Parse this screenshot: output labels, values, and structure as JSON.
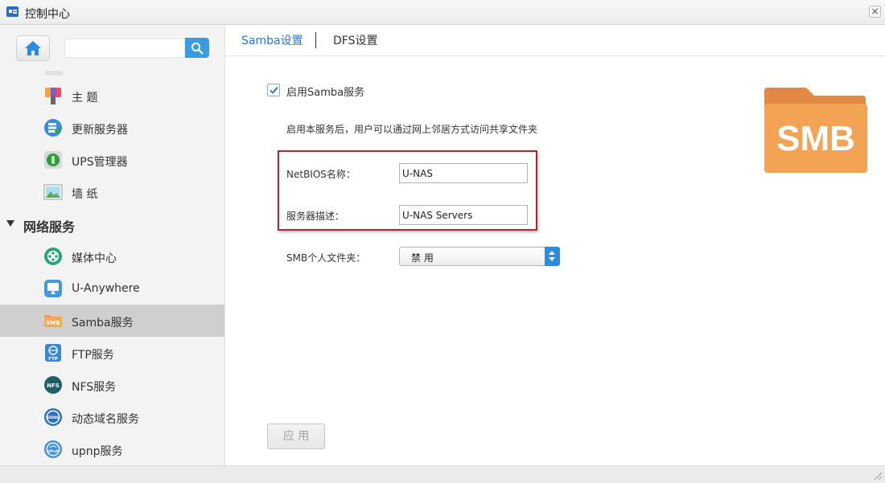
{
  "window": {
    "title": "控制中心"
  },
  "sidebar": {
    "search": {
      "value": "",
      "placeholder": ""
    },
    "items_top": [
      {
        "label": "主 题",
        "icon": "theme-icon"
      },
      {
        "label": "更新服务器",
        "icon": "update-server-icon"
      },
      {
        "label": "UPS管理器",
        "icon": "ups-icon"
      },
      {
        "label": "墙 纸",
        "icon": "wallpaper-icon"
      }
    ],
    "section": {
      "label": "网络服务"
    },
    "items_network": [
      {
        "label": "媒体中心",
        "icon": "media-center-icon"
      },
      {
        "label": "U-Anywhere",
        "icon": "u-anywhere-icon"
      },
      {
        "label": "Samba服务",
        "icon": "samba-icon",
        "selected": true
      },
      {
        "label": "FTP服务",
        "icon": "ftp-icon"
      },
      {
        "label": "NFS服务",
        "icon": "nfs-icon"
      },
      {
        "label": "动态域名服务",
        "icon": "ddns-icon"
      },
      {
        "label": "upnp服务",
        "icon": "upnp-icon"
      }
    ],
    "icon_texts": {
      "smb": "SMB",
      "ftp": "FTP",
      "nfs": "NFS",
      "ddns": "DDNS",
      "upnp": "UPnP"
    }
  },
  "tabs": [
    {
      "label": "Samba设置",
      "active": true
    },
    {
      "label": "DFS设置",
      "active": false
    }
  ],
  "form": {
    "enable_label": "启用Samba服务",
    "enable_checked": true,
    "description": "启用本服务后，用户可以通过网上邻居方式访问共享文件夹",
    "netbios_label": "NetBIOS名称：",
    "netbios_value": "U-NAS",
    "server_desc_label": "服务器描述：",
    "server_desc_value": "U-NAS Servers",
    "smb_home_label": "SMB个人文件夹：",
    "smb_home_value": "禁 用",
    "apply_label": "应 用"
  },
  "folder_badge": "SMB",
  "colors": {
    "accent": "#1f7ad0",
    "highlight_border": "#b0272d",
    "folder": "#f0a050",
    "select_arrow": "#2d8ae0"
  }
}
